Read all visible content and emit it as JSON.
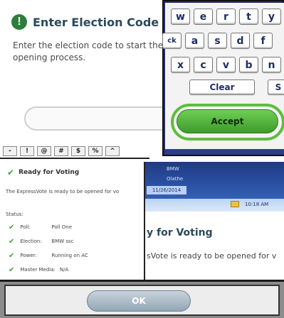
{
  "election_code": {
    "title": "Enter Election Code",
    "alert_icon": "!",
    "description": "Enter the election code to start the opening process.",
    "input_value": "",
    "symbol_keys": [
      "-",
      "!",
      "@",
      "#",
      "$",
      "%",
      "^"
    ]
  },
  "keyboard": {
    "row1": [
      "w",
      "e",
      "r",
      "t",
      "y"
    ],
    "row2": [
      "ck",
      "a",
      "s",
      "d",
      "f"
    ],
    "row3": [
      "x",
      "c",
      "v",
      "b",
      "n"
    ],
    "clear_label": "Clear",
    "partial_key_label": "S",
    "accept_label": "Accept"
  },
  "ready_small": {
    "title": "Ready for Voting",
    "description": "The ExpressVote is ready to be opened for vo",
    "status_heading": "Status:",
    "status_items": [
      {
        "label": "Poll:",
        "value": "Poll One"
      },
      {
        "label": "Election:",
        "value": "BMW ssc"
      },
      {
        "label": "Power:",
        "value": "Running on AC"
      },
      {
        "label": "Master Media:",
        "value": "N/A"
      }
    ]
  },
  "status_bar": {
    "line1": "BMW",
    "line2": "Olathe",
    "date": "11/26/2014",
    "time": "10:18 AM"
  },
  "ready_large": {
    "title": "y for Voting",
    "description": "sVote is ready to be opened for v"
  },
  "ok_button": {
    "label": "OK"
  },
  "colors": {
    "accent_green": "#3e9a2c",
    "status_bar_blue": "#1f3a86",
    "title_text": "#2b4a5c"
  }
}
